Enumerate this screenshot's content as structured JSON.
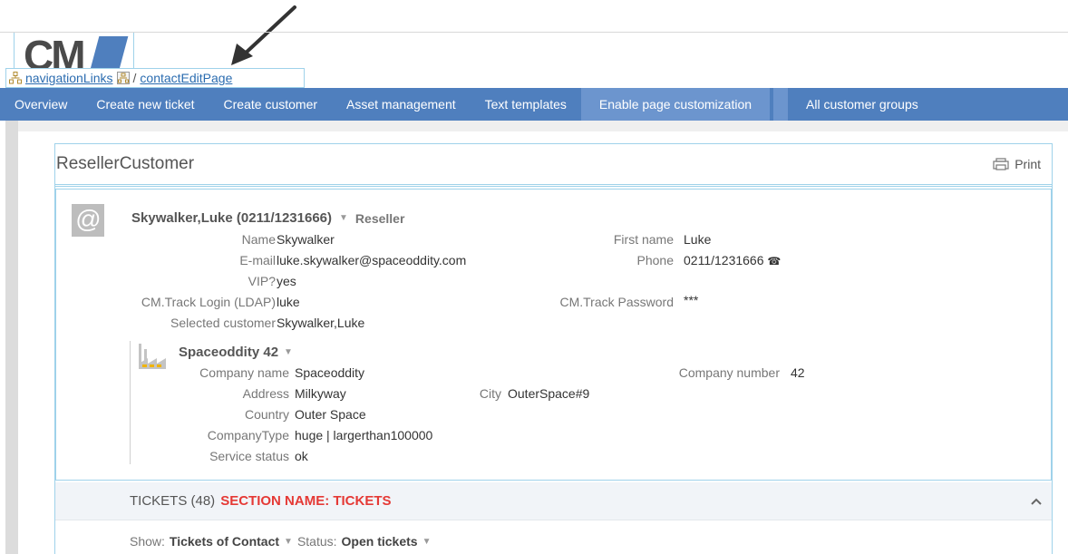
{
  "logo": {
    "text": "CM"
  },
  "breadcrumb": {
    "first": "navigationLinks",
    "separator": "/",
    "second": "contactEditPage"
  },
  "nav": {
    "items": [
      {
        "label": "Overview"
      },
      {
        "label": "Create new ticket"
      },
      {
        "label": "Create customer"
      },
      {
        "label": "Asset management"
      },
      {
        "label": "Text templates"
      },
      {
        "label": "Enable page customization"
      }
    ],
    "right_item": "All customer groups"
  },
  "panel": {
    "title": "ResellerCustomer",
    "print_label": "Print"
  },
  "contact": {
    "icon": "@",
    "title": "Skywalker,Luke (0211/1231666)",
    "role": "Reseller",
    "fields": {
      "name_label": "Name",
      "name": "Skywalker",
      "email_label": "E-mail",
      "email": "luke.skywalker@spaceoddity.com",
      "vip_label": "VIP?",
      "vip": "yes",
      "login_label": "CM.Track Login (LDAP)",
      "login": "luke",
      "selected_label": "Selected customer",
      "selected": "Skywalker,Luke",
      "firstname_label": "First name",
      "firstname": "Luke",
      "phone_label": "Phone",
      "phone": "0211/1231666",
      "password_label": "CM.Track Password",
      "password": "***"
    }
  },
  "company": {
    "title": "Spaceoddity 42",
    "fields": {
      "name_label": "Company name",
      "name": "Spaceoddity",
      "address_label": "Address",
      "address": "Milkyway",
      "country_label": "Country",
      "country": "Outer Space",
      "type_label": "CompanyType",
      "type": "huge | largerthan100000",
      "status_label": "Service status",
      "status": "ok",
      "city_label": "City",
      "city": "OuterSpace#9",
      "number_label": "Company number",
      "number": "42"
    }
  },
  "tickets": {
    "title": "TICKETS (48)",
    "note": "SECTION NAME: TICKETS",
    "show_label": "Show:",
    "show_value": "Tickets of Contact",
    "status_label": "Status:",
    "status_value": "Open tickets"
  },
  "colors": {
    "nav_bg": "#4f7fbe",
    "nav_active": "#6c95ce",
    "accent_red": "#e53935",
    "border": "#9fd2ea"
  }
}
